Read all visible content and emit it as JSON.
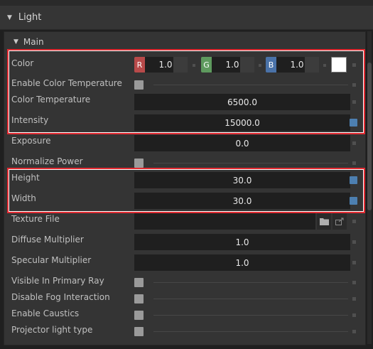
{
  "section": {
    "title": "Light"
  },
  "group": {
    "title": "Main"
  },
  "color": {
    "label": "Color",
    "r_tag": "R",
    "r": "1.0",
    "g_tag": "G",
    "g": "1.0",
    "b_tag": "B",
    "b": "1.0",
    "swatch": "#ffffff"
  },
  "props": {
    "enable_color_temperature": "Enable Color Temperature",
    "color_temperature": {
      "label": "Color Temperature",
      "value": "6500.0"
    },
    "intensity": {
      "label": "Intensity",
      "value": "15000.0"
    },
    "exposure": {
      "label": "Exposure",
      "value": "0.0"
    },
    "normalize_power": "Normalize Power",
    "height": {
      "label": "Height",
      "value": "30.0"
    },
    "width": {
      "label": "Width",
      "value": "30.0"
    },
    "texture_file": {
      "label": "Texture File",
      "value": ""
    },
    "diffuse_multiplier": {
      "label": "Diffuse Multiplier",
      "value": "1.0"
    },
    "specular_multiplier": {
      "label": "Specular Multiplier",
      "value": "1.0"
    },
    "visible_in_primary_ray": "Visible In Primary Ray",
    "disable_fog_interaction": "Disable Fog Interaction",
    "enable_caustics": "Enable Caustics",
    "projector_light_type": "Projector light type"
  },
  "icons": {
    "folder": "folder-icon",
    "locate": "locate-file-icon",
    "expand": "caret-down-icon"
  },
  "colors": {
    "highlight": "#e22b32",
    "animated_key": "#4d7fb0",
    "r": "#b84a4a",
    "g": "#5e9a5e",
    "b": "#4a72a8"
  }
}
